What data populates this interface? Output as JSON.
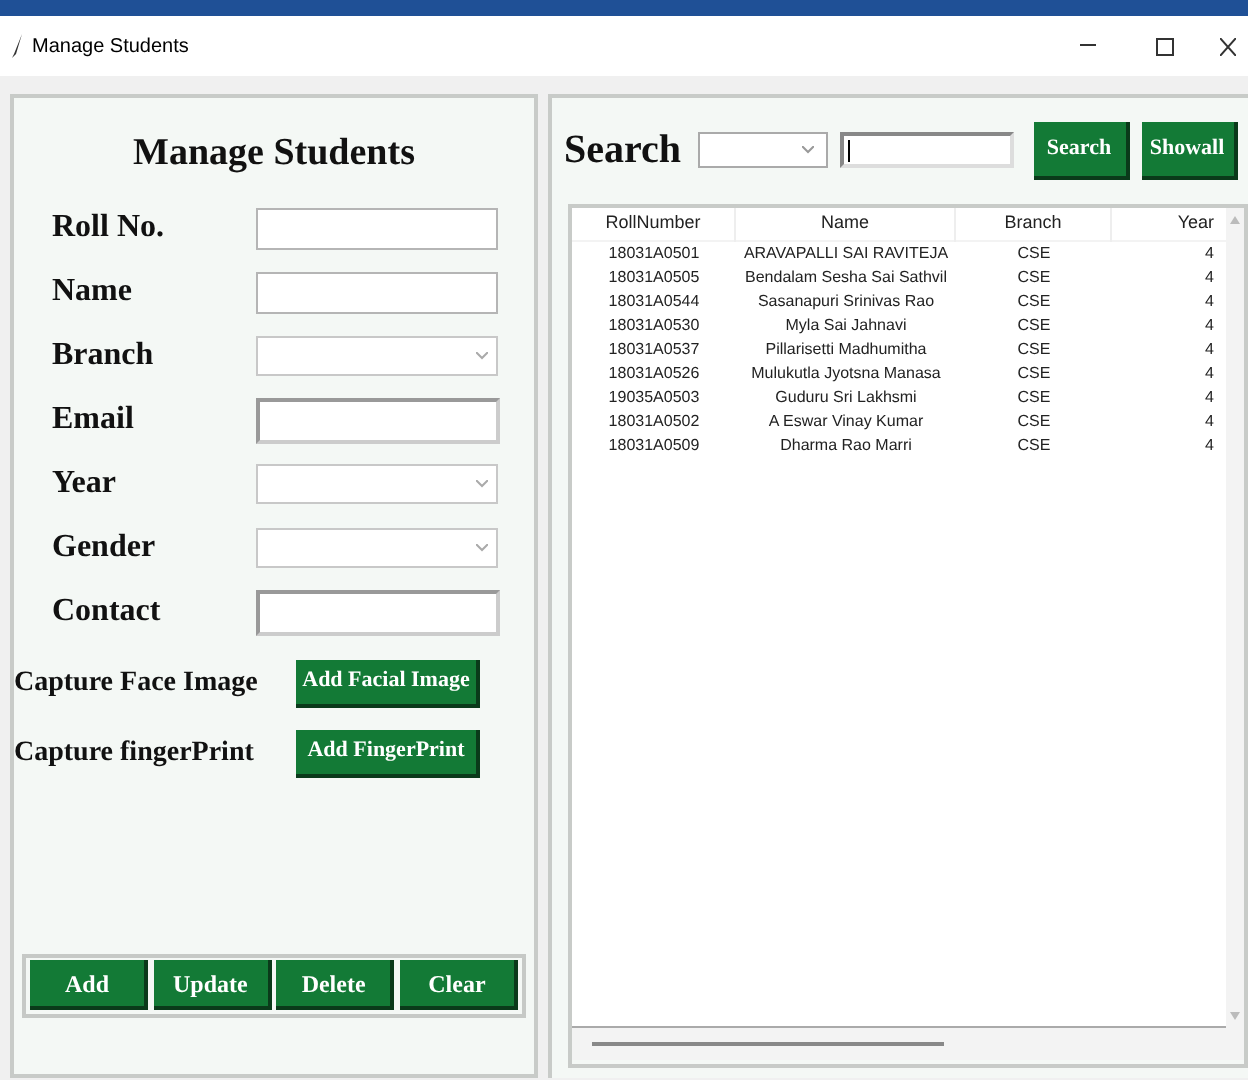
{
  "window": {
    "title": "Manage Students"
  },
  "form": {
    "title": "Manage Students",
    "fields": [
      {
        "label": "Roll No.",
        "kind": "entry"
      },
      {
        "label": "Name",
        "kind": "entry"
      },
      {
        "label": "Branch",
        "kind": "combo"
      },
      {
        "label": "Email",
        "kind": "sunken"
      },
      {
        "label": "Year",
        "kind": "combo"
      },
      {
        "label": "Gender",
        "kind": "combo"
      },
      {
        "label": "Contact",
        "kind": "sunken"
      }
    ],
    "captures": [
      {
        "label": "Capture Face Image",
        "button": "Add Facial Image"
      },
      {
        "label": "Capture fingerPrint",
        "button": "Add FingerPrint"
      }
    ],
    "actions": [
      "Add",
      "Update",
      "Delete",
      "Clear"
    ]
  },
  "search": {
    "label": "Search",
    "buttons": [
      "Search",
      "Showall"
    ]
  },
  "table": {
    "columns": [
      "RollNumber",
      "Name",
      "Branch",
      "Year"
    ],
    "rows": [
      [
        "18031A0501",
        "ARAVAPALLI SAI RAVITEJA",
        "CSE",
        "4"
      ],
      [
        "18031A0505",
        "Bendalam Sesha Sai Sathvil",
        "CSE",
        "4"
      ],
      [
        "18031A0544",
        "Sasanapuri Srinivas Rao",
        "CSE",
        "4"
      ],
      [
        "18031A0530",
        "Myla Sai Jahnavi",
        "CSE",
        "4"
      ],
      [
        "18031A0537",
        "Pillarisetti Madhumitha",
        "CSE",
        "4"
      ],
      [
        "18031A0526",
        "Mulukutla Jyotsna Manasa",
        "CSE",
        "4"
      ],
      [
        "19035A0503",
        "Guduru Sri Lakhsmi",
        "CSE",
        "4"
      ],
      [
        "18031A0502",
        "A Eswar Vinay Kumar",
        "CSE",
        "4"
      ],
      [
        "18031A0509",
        "Dharma Rao Marri",
        "CSE",
        "4"
      ]
    ]
  }
}
